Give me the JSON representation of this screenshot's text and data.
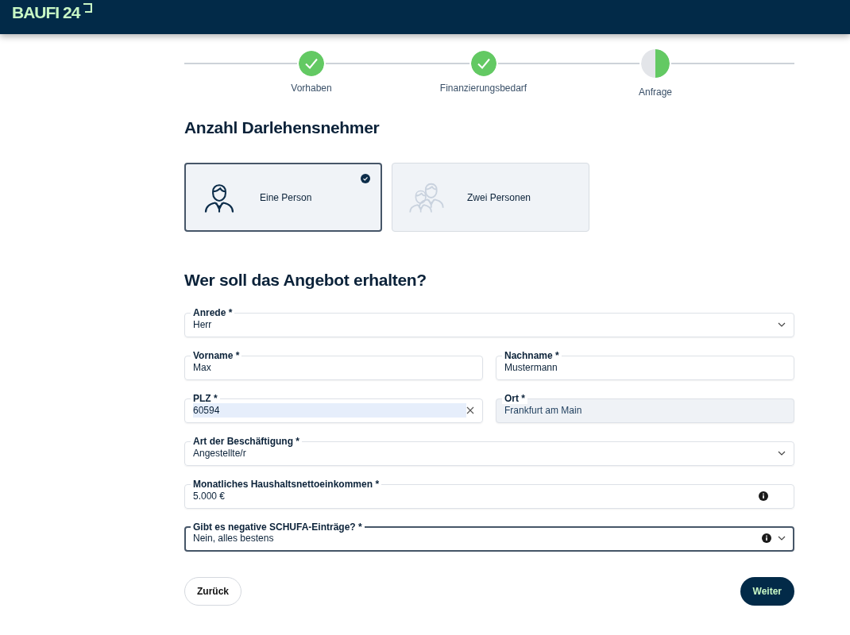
{
  "header": {
    "logo": "BAUFI 24"
  },
  "steps": [
    {
      "label": "Vorhaben",
      "completed": true
    },
    {
      "label": "Finanzierungsbedarf",
      "completed": true
    },
    {
      "label": "Anfrage",
      "completed": false
    }
  ],
  "borrowers": {
    "title": "Anzahl Darlehensnehmer",
    "options": [
      {
        "label": "Eine Person",
        "kind": "single",
        "selected": true
      },
      {
        "label": "Zwei Personen",
        "kind": "couple",
        "selected": false
      }
    ]
  },
  "recipient": {
    "title": "Wer soll das Angebot erhalten?",
    "rows": [
      {
        "fields": [
          {
            "label": "Anrede *",
            "value": "Herr",
            "kind": "select",
            "info": false,
            "focused": false
          }
        ]
      },
      {
        "fields": [
          {
            "label": "Vorname *",
            "value": "Max",
            "kind": "text",
            "focused": false
          },
          {
            "label": "Nachname *",
            "value": "Mustermann",
            "kind": "text",
            "focused": false
          }
        ]
      },
      {
        "fields": [
          {
            "label": "PLZ *",
            "value": "60594",
            "kind": "text",
            "highlighted": true,
            "clearable": true,
            "focused": false
          },
          {
            "label": "Ort *",
            "value": "Frankfurt am Main",
            "kind": "readonly",
            "focused": false
          }
        ]
      },
      {
        "fields": [
          {
            "label": "Art der Beschäftigung *",
            "value": "Angestellte/r",
            "kind": "select",
            "info": false,
            "focused": false
          }
        ]
      },
      {
        "fields": [
          {
            "label": "Monatliches Haushaltsnettoeinkommen *",
            "value": "5.000 €",
            "kind": "text",
            "info": true,
            "focused": false
          }
        ]
      },
      {
        "fields": [
          {
            "label": "Gibt es negative SCHUFA-Einträge? *",
            "value": "Nein, alles bestens",
            "kind": "select",
            "info": true,
            "focused": true
          }
        ]
      }
    ]
  },
  "buttons": {
    "back": "Zurück",
    "next": "Weiter"
  }
}
